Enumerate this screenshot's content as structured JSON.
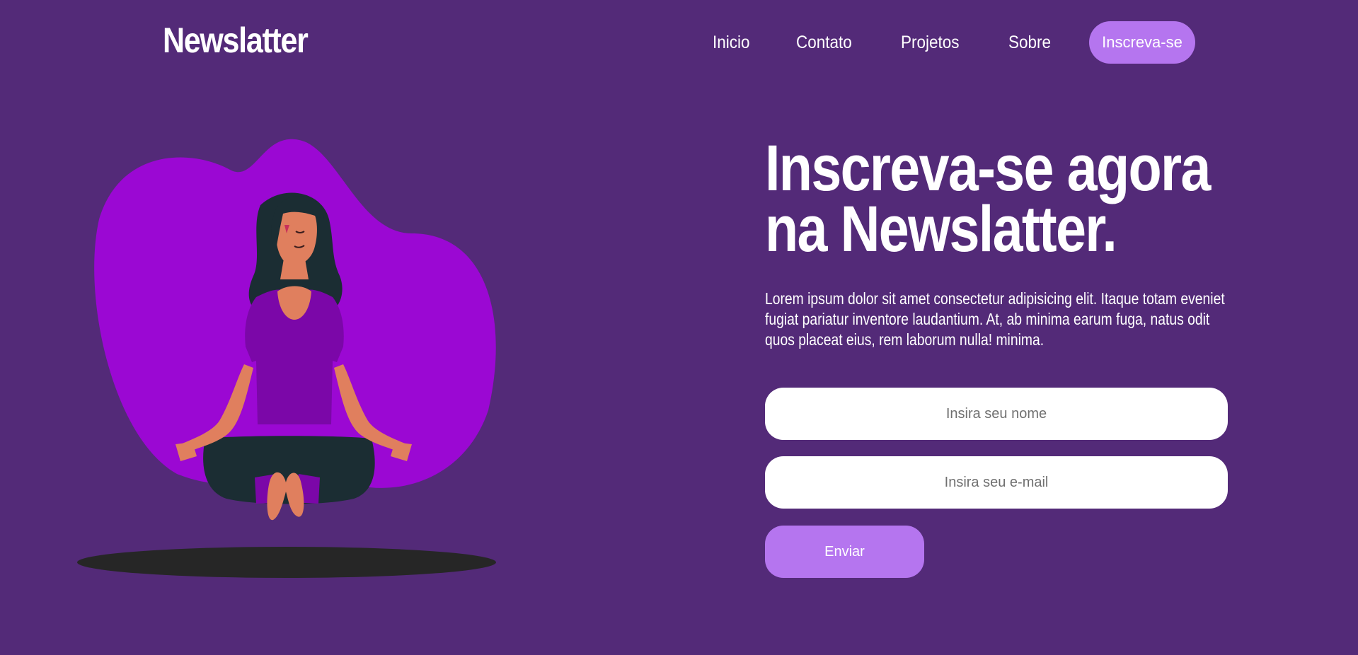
{
  "header": {
    "logo": "Newslatter",
    "nav": [
      "Inicio",
      "Contato",
      "Projetos",
      "Sobre"
    ],
    "cta_label": "Inscreva-se"
  },
  "hero": {
    "title_line1": "Inscreva-se agora",
    "title_line2": "na Newslatter.",
    "description": "Lorem ipsum dolor sit amet consectetur adipisicing elit. Itaque totam eveniet fugiat pariatur inventore laudantium. At, ab minima earum fuga, natus odit quos placeat eius, rem laborum nulla! minima."
  },
  "form": {
    "name_placeholder": "Insira seu nome",
    "email_placeholder": "Insira seu e-mail",
    "submit_label": "Enviar"
  },
  "colors": {
    "background": "#532a78",
    "accent": "#b575ef",
    "blob": "#9b08d3"
  },
  "illustration": {
    "icon": "meditating-woman-illustration"
  }
}
